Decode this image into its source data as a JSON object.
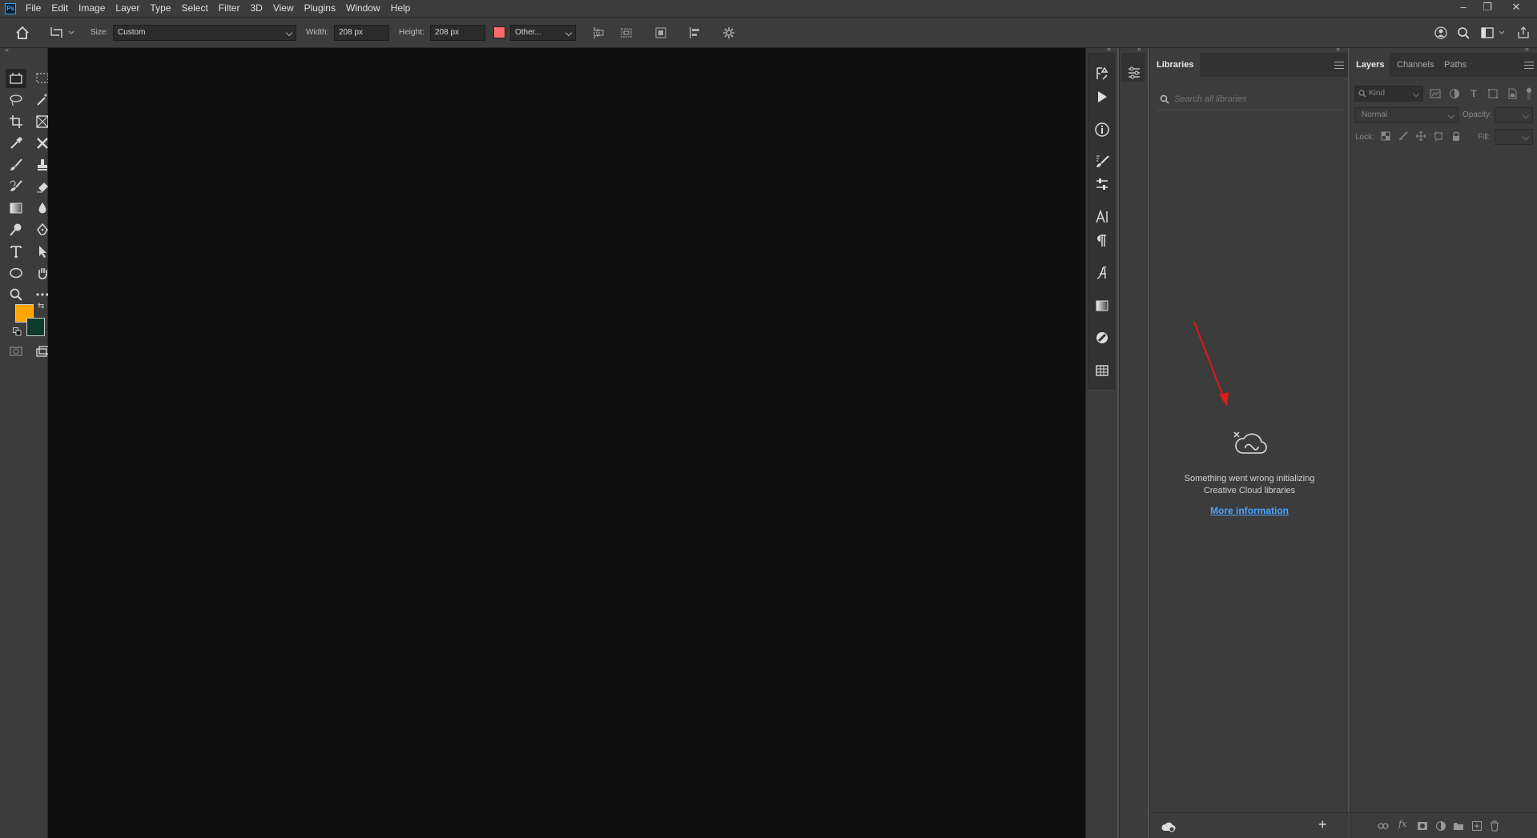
{
  "app": {
    "logo": "Ps",
    "menu": [
      "File",
      "Edit",
      "Image",
      "Layer",
      "Type",
      "Select",
      "Filter",
      "3D",
      "View",
      "Plugins",
      "Window",
      "Help"
    ],
    "window_controls": [
      "minimize-icon",
      "restore-icon",
      "close-icon"
    ]
  },
  "options_bar": {
    "size_label": "Size:",
    "size_value": "Custom",
    "width_label": "Width:",
    "width_value": "208 px",
    "height_label": "Height:",
    "height_value": "208 px",
    "fill_color": "#ff6b6b",
    "other_label": "Other...",
    "right_icons": [
      "share-person-icon",
      "search-icon",
      "workspace-icon",
      "share-icon"
    ]
  },
  "toolbar": {
    "foreground_color": "#ffa500",
    "background_color": "#0e3b2e",
    "tools": [
      "frame-tool",
      "marquee-tool",
      "lasso-tool",
      "magic-wand-tool",
      "crop-tool",
      "frame-crop-tool",
      "eyedropper-tool",
      "healing-tool",
      "brush-tool",
      "stamp-tool",
      "history-brush-tool",
      "eraser-tool",
      "gradient-tool",
      "blur-tool",
      "dodge-tool",
      "pen-tool",
      "type-tool",
      "path-selection-tool",
      "shape-tool",
      "hand-tool",
      "zoom-tool",
      "more-tools"
    ]
  },
  "libraries": {
    "tab": "Libraries",
    "search_placeholder": "Search all libraries",
    "error_line1": "Something went wrong initializing",
    "error_line2": "Creative Cloud libraries",
    "more_info": "More information",
    "arrow_color": "#e0181b"
  },
  "layers": {
    "tabs": [
      "Layers",
      "Channels",
      "Paths"
    ],
    "kind_placeholder": "Kind",
    "blend_mode": "Normal",
    "opacity_label": "Opacity:",
    "lock_label": "Lock:",
    "fill_label": "Fill:"
  }
}
